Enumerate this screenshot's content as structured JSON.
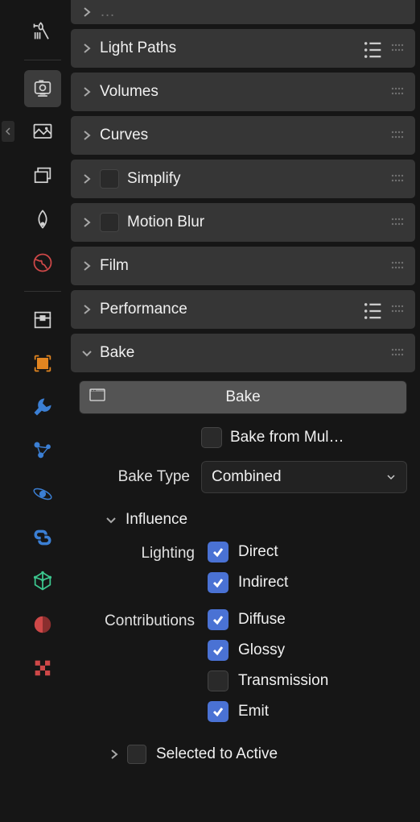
{
  "sidebar": {
    "tabs": [
      {
        "name": "tool-icon",
        "color": "#d0d0d0"
      },
      {
        "name": "render-icon",
        "color": "#d0d0d0",
        "active": true
      },
      {
        "name": "output-icon",
        "color": "#d0d0d0"
      },
      {
        "name": "view-layer-icon",
        "color": "#d0d0d0"
      },
      {
        "name": "droplet-icon",
        "color": "#d0d0d0"
      },
      {
        "name": "world-icon",
        "color": "#ce4848"
      },
      {
        "name": "collection-icon",
        "color": "#d0d0d0"
      },
      {
        "name": "object-icon",
        "color": "#e28520"
      },
      {
        "name": "modifier-icon",
        "color": "#3b7fd4"
      },
      {
        "name": "particle-icon",
        "color": "#3b7fd4"
      },
      {
        "name": "physics-icon",
        "color": "#3b7fd4"
      },
      {
        "name": "constraint-icon",
        "color": "#3b7fd4"
      },
      {
        "name": "object-data-icon",
        "color": "#3cc78f"
      },
      {
        "name": "material-icon",
        "color": "#ce4848"
      },
      {
        "name": "texture-icon",
        "color": "#ce4848"
      }
    ]
  },
  "panels": [
    {
      "label": "Light Paths",
      "checkbox": false,
      "preset": true
    },
    {
      "label": "Volumes",
      "checkbox": false,
      "preset": false
    },
    {
      "label": "Curves",
      "checkbox": false,
      "preset": false
    },
    {
      "label": "Simplify",
      "checkbox": true,
      "preset": false
    },
    {
      "label": "Motion Blur",
      "checkbox": true,
      "preset": false
    },
    {
      "label": "Film",
      "checkbox": false,
      "preset": false
    },
    {
      "label": "Performance",
      "checkbox": false,
      "preset": true
    }
  ],
  "bake": {
    "panel_label": "Bake",
    "button_label": "Bake",
    "from_multires_label": "Bake from Mul…",
    "from_multires_checked": false,
    "type_label": "Bake Type",
    "type_value": "Combined",
    "influence": {
      "label": "Influence",
      "lighting_label": "Lighting",
      "lighting_items": [
        {
          "label": "Direct",
          "checked": true
        },
        {
          "label": "Indirect",
          "checked": true
        }
      ],
      "contrib_label": "Contributions",
      "contrib_items": [
        {
          "label": "Diffuse",
          "checked": true
        },
        {
          "label": "Glossy",
          "checked": true
        },
        {
          "label": "Transmission",
          "checked": false
        },
        {
          "label": "Emit",
          "checked": true
        }
      ]
    },
    "selected_to_active_label": "Selected to Active"
  }
}
